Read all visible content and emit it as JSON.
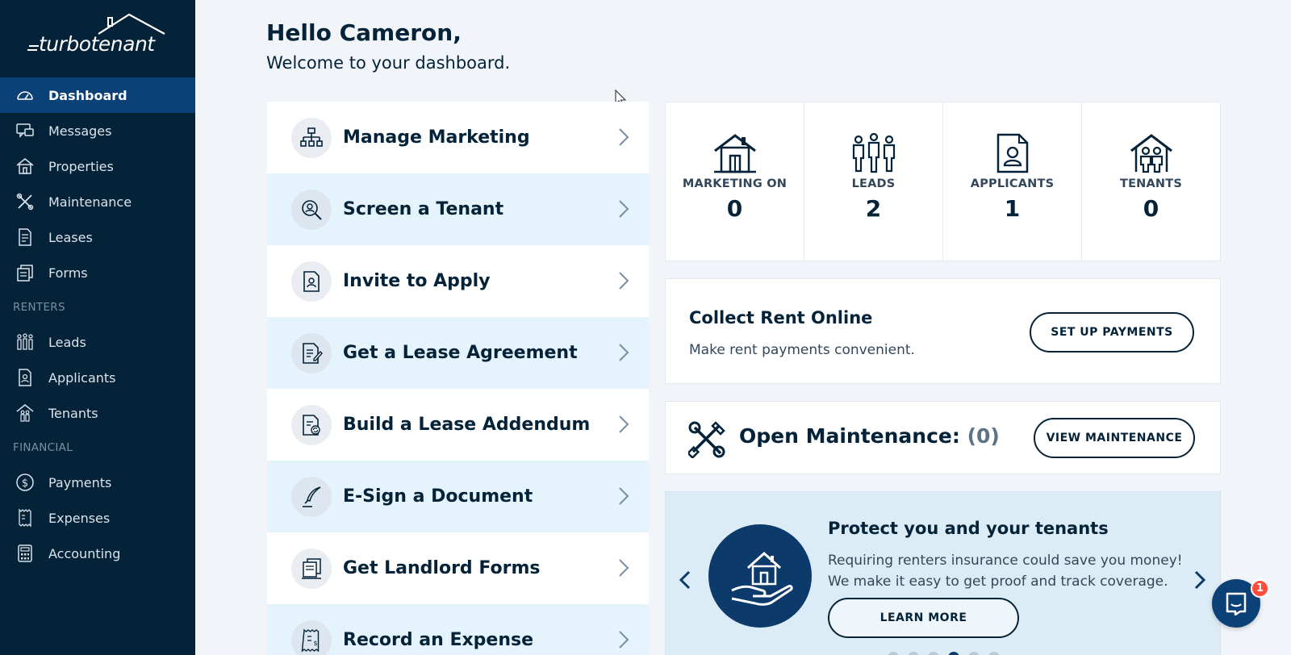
{
  "brand": {
    "name": "turbotenant"
  },
  "sidebar": {
    "items": [
      {
        "label": "Dashboard",
        "icon": "dashboard-icon",
        "active": true
      },
      {
        "label": "Messages",
        "icon": "messages-icon"
      },
      {
        "label": "Properties",
        "icon": "properties-icon"
      },
      {
        "label": "Maintenance",
        "icon": "maintenance-icon"
      },
      {
        "label": "Leases",
        "icon": "leases-icon"
      },
      {
        "label": "Forms",
        "icon": "forms-icon"
      }
    ],
    "renters_heading": "RENTERS",
    "renters": [
      {
        "label": "Leads",
        "icon": "leads-icon"
      },
      {
        "label": "Applicants",
        "icon": "applicants-icon"
      },
      {
        "label": "Tenants",
        "icon": "tenants-icon"
      }
    ],
    "financial_heading": "FINANCIAL",
    "financial": [
      {
        "label": "Payments",
        "icon": "payments-icon"
      },
      {
        "label": "Expenses",
        "icon": "expenses-icon"
      },
      {
        "label": "Accounting",
        "icon": "accounting-icon"
      }
    ]
  },
  "header": {
    "greeting": "Hello Cameron,",
    "subtitle": "Welcome to your dashboard."
  },
  "actions": [
    {
      "label": "Manage Marketing",
      "icon": "sitemap-icon"
    },
    {
      "label": "Screen a Tenant",
      "icon": "search-person-icon"
    },
    {
      "label": "Invite to Apply",
      "icon": "applicant-card-icon"
    },
    {
      "label": "Get a Lease Agreement",
      "icon": "lease-document-icon"
    },
    {
      "label": "Build a Lease Addendum",
      "icon": "addendum-document-icon"
    },
    {
      "label": "E-Sign a Document",
      "icon": "quill-pen-icon"
    },
    {
      "label": "Get Landlord Forms",
      "icon": "forms-stack-icon"
    },
    {
      "label": "Record an Expense",
      "icon": "receipt-icon"
    }
  ],
  "stats": [
    {
      "label": "MARKETING ON",
      "value": "0",
      "icon": "house-icon"
    },
    {
      "label": "LEADS",
      "value": "2",
      "icon": "people-icon"
    },
    {
      "label": "APPLICANTS",
      "value": "1",
      "icon": "applicant-icon"
    },
    {
      "label": "TENANTS",
      "value": "0",
      "icon": "tenants-house-icon"
    }
  ],
  "rent": {
    "title": "Collect Rent Online",
    "subtitle": "Make rent payments convenient.",
    "button": "SET UP PAYMENTS"
  },
  "maintenance": {
    "title": "Open Maintenance:",
    "count": "(0)",
    "button": "VIEW MAINTENANCE"
  },
  "promo": {
    "title": "Protect you and your tenants",
    "line1": "Requiring renters insurance could save you money!",
    "line2": "We make it easy to get proof and track coverage.",
    "button": "LEARN MORE",
    "active_dot": 3
  },
  "chat": {
    "badge": "1"
  },
  "colors": {
    "navy": "#042238",
    "sidebar_active": "#0b4176",
    "highlight_row": "#e5f4fc",
    "badge": "#ff4d3a"
  }
}
